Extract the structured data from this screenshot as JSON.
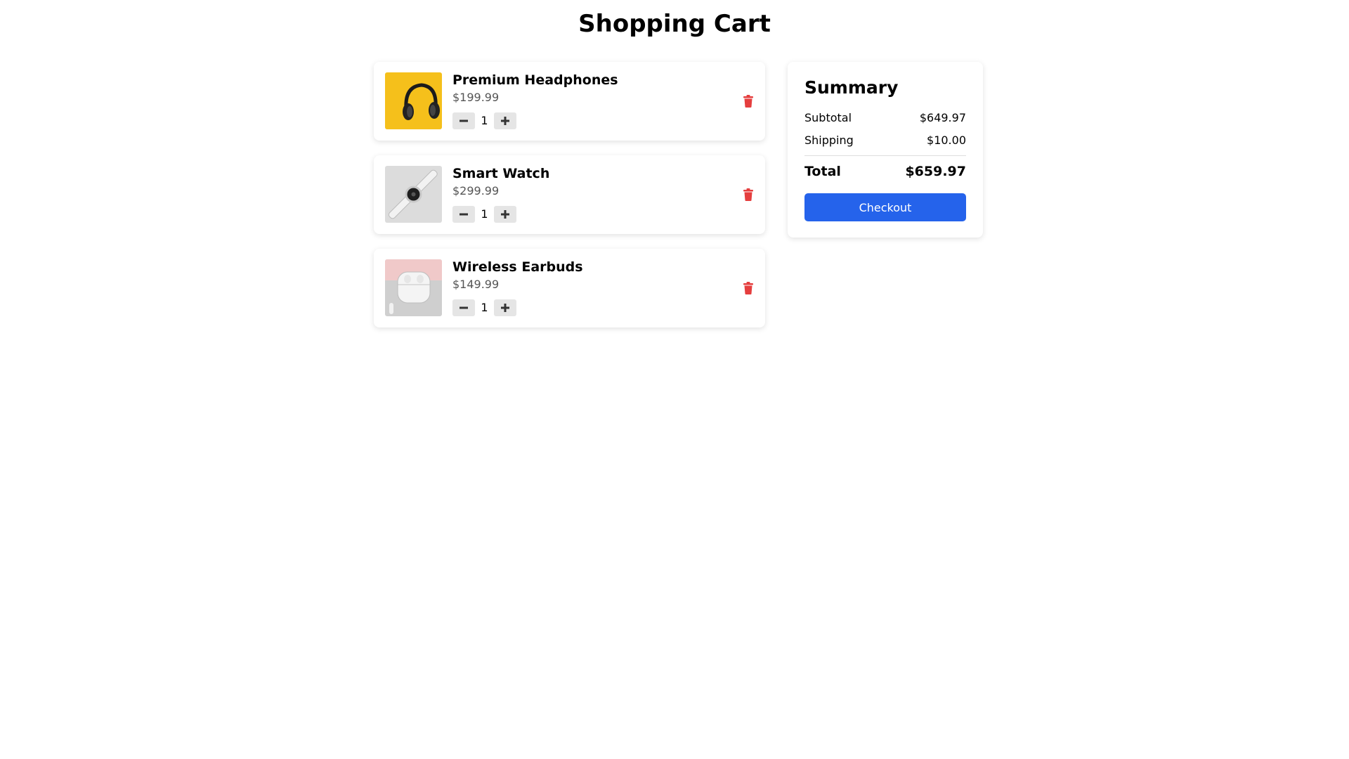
{
  "page": {
    "title": "Shopping Cart"
  },
  "cart": {
    "items": [
      {
        "name": "Premium Headphones",
        "price": "$199.99",
        "quantity": "1",
        "image": "headphones-photo"
      },
      {
        "name": "Smart Watch",
        "price": "$299.99",
        "quantity": "1",
        "image": "smartwatch-photo"
      },
      {
        "name": "Wireless Earbuds",
        "price": "$149.99",
        "quantity": "1",
        "image": "earbuds-photo"
      }
    ],
    "icons": {
      "decrease": "minus-icon",
      "increase": "plus-icon",
      "remove": "trash-icon"
    }
  },
  "summary": {
    "title": "Summary",
    "subtotal_label": "Subtotal",
    "subtotal_value": "$649.97",
    "shipping_label": "Shipping",
    "shipping_value": "$10.00",
    "total_label": "Total",
    "total_value": "$659.97",
    "checkout_label": "Checkout"
  },
  "colors": {
    "accent": "#2563eb",
    "danger": "#e53e3e",
    "qty_button_bg": "#e5e5e5",
    "price_text": "#555555"
  }
}
